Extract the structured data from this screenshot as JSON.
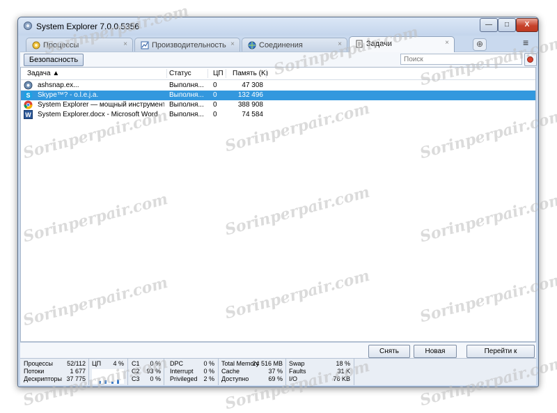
{
  "window": {
    "title": "System Explorer 7.0.0.5356",
    "min_glyph": "—",
    "max_glyph": "□",
    "close_glyph": "X"
  },
  "tabs": [
    {
      "label": "Процессы",
      "icon": "processes-icon",
      "close": "×"
    },
    {
      "label": "Производительность",
      "icon": "performance-icon",
      "close": "×"
    },
    {
      "label": "Соединения",
      "icon": "connections-icon",
      "close": "×"
    },
    {
      "label": "Задачи",
      "icon": "tasks-icon",
      "close": "×"
    }
  ],
  "toolbar": {
    "security_label": "Безопасность",
    "search_placeholder": "Поиск",
    "add_tab_glyph": "⊕",
    "menu_glyph": "≡"
  },
  "table": {
    "headers": {
      "task": "Задача ▲",
      "status": "Статус",
      "cpu": "ЦП",
      "memory": "Память (K)"
    },
    "rows": [
      {
        "task": "ashsnap.ex...",
        "status": "Выполня...",
        "cpu": "0",
        "memory": "47 308",
        "icon": "app-gear-icon"
      },
      {
        "task": "Skype™? - o.l.e.j.a.",
        "status": "Выполня...",
        "cpu": "0",
        "memory": "132 496",
        "icon": "skype-icon"
      },
      {
        "task": "System Explorer — мощный инструмент дл...",
        "status": "Выполня...",
        "cpu": "0",
        "memory": "388 908",
        "icon": "chrome-icon"
      },
      {
        "task": "System Explorer.docx - Microsoft Word",
        "status": "Выполня...",
        "cpu": "0",
        "memory": "74 584",
        "icon": "word-icon"
      }
    ]
  },
  "buttons": {
    "end_task": "Снять задачу",
    "new_task": "Новая задача",
    "switch_to": "Перейти к приложению"
  },
  "status": {
    "processes_label": "Процессы",
    "processes_value": "52/112",
    "threads_label": "Потоки",
    "threads_value": "1 677",
    "handles_label": "Дескрипторы",
    "handles_value": "37 775",
    "cpu_label": "ЦП",
    "cpu_value": "4 %",
    "c1_label": "C1",
    "c1_value": "0 %",
    "c2_label": "C2",
    "c2_value": "93 %",
    "c3_label": "C3",
    "c3_value": "0 %",
    "dpc_label": "DPC",
    "dpc_value": "0 %",
    "interrupt_label": "Interrupt",
    "interrupt_value": "0 %",
    "privileged_label": "Privileged",
    "privileged_value": "2 %",
    "total_memory_label": "Total Memory",
    "total_memory_value": "24 516 MB",
    "cache_label": "Cache",
    "cache_value": "37 %",
    "available_label": "Доступно",
    "available_value": "69 %",
    "swap_label": "Swap",
    "swap_value": "18 %",
    "faults_label": "Faults",
    "faults_value": "31 K",
    "io_label": "I/O",
    "io_value": "76 KB"
  },
  "watermark": "Sorinperpair.com",
  "colors": {
    "selection": "#3398de",
    "title_bg": "#c9d9ee",
    "close_button": "#c7432c"
  }
}
